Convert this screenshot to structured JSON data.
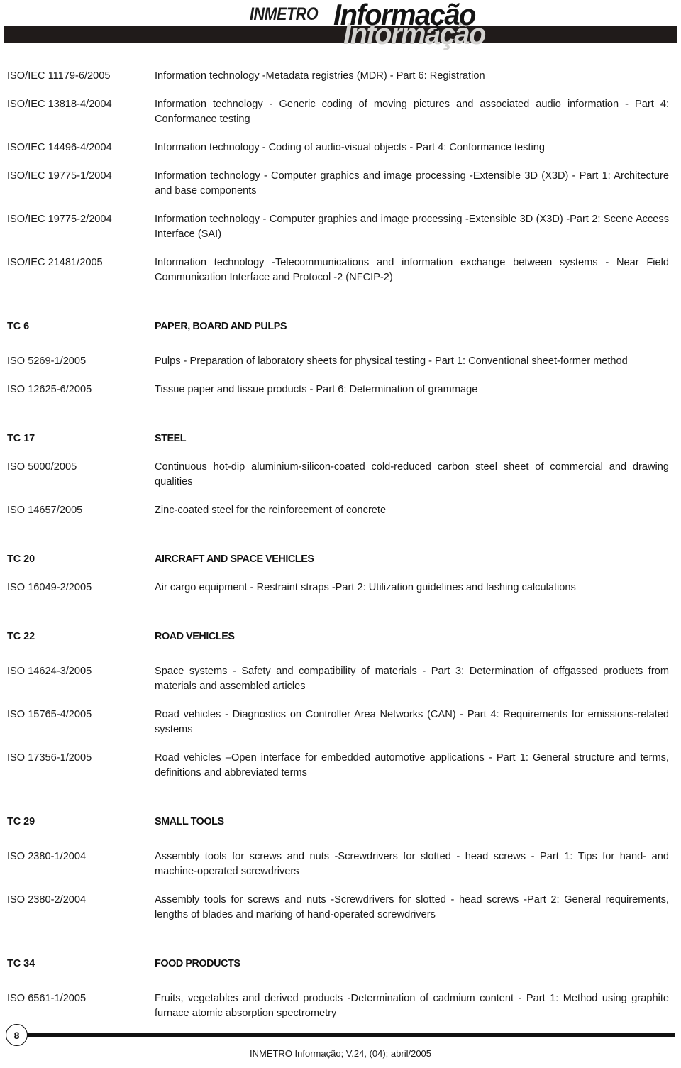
{
  "masthead": {
    "brand": "INMETRO",
    "title": "Informação",
    "title_echo": "Informação",
    "bar_color": "#201b1a",
    "echo_color": "#d3d2d0"
  },
  "sections": [
    {
      "tc_code": "",
      "tc_name": "",
      "entries": [
        {
          "code": "ISO/IEC 11179-6/2005",
          "title": "Information technology -Metadata registries (MDR) - Part 6: Registration"
        },
        {
          "code": "ISO/IEC 13818-4/2004",
          "title": "Information technology - Generic coding of moving pictures and associated audio information - Part 4: Conformance testing"
        },
        {
          "code": "ISO/IEC 14496-4/2004",
          "title": "Information technology - Coding of audio-visual objects - Part 4: Conformance testing"
        },
        {
          "code": "ISO/IEC 19775-1/2004",
          "title": "Information technology - Computer graphics and image processing -Extensible 3D (X3D) - Part 1: Architecture and base components"
        },
        {
          "code": "ISO/IEC 19775-2/2004",
          "title": "Information technology - Computer graphics and image processing -Extensible 3D (X3D) -Part 2: Scene Access Interface (SAI)"
        },
        {
          "code": "ISO/IEC 21481/2005",
          "title": "Information technology -Telecommunications and information exchange between systems - Near Field Communication Interface and Protocol -2 (NFCIP-2)"
        }
      ]
    },
    {
      "tc_code": "TC 6",
      "tc_name": "PAPER, BOARD AND PULPS",
      "entries": [
        {
          "code": "ISO 5269-1/2005",
          "title": "Pulps - Preparation of laboratory sheets for physical testing - Part 1: Conventional sheet-former method"
        },
        {
          "code": "ISO 12625-6/2005",
          "title": "Tissue paper and tissue products - Part 6: Determination of grammage"
        }
      ]
    },
    {
      "tc_code": "TC 17",
      "tc_name": "STEEL",
      "entries": [
        {
          "code": "ISO 5000/2005",
          "title": "Continuous hot-dip aluminium-silicon-coated cold-reduced carbon steel sheet of commercial and drawing qualities"
        },
        {
          "code": "ISO 14657/2005",
          "title": "Zinc-coated steel for the reinforcement of concrete"
        }
      ]
    },
    {
      "tc_code": "TC 20",
      "tc_name": "AIRCRAFT AND SPACE VEHICLES",
      "entries": [
        {
          "code": "ISO 16049-2/2005",
          "title": "Air cargo equipment - Restraint straps -Part 2: Utilization guidelines and lashing calculations"
        }
      ]
    },
    {
      "tc_code": "TC 22",
      "tc_name": "ROAD VEHICLES",
      "entries": [
        {
          "code": "ISO 14624-3/2005",
          "title": "Space systems - Safety and compatibility of materials - Part 3: Determination of offgassed products from materials and assembled articles"
        },
        {
          "code": "ISO 15765-4/2005",
          "title": "Road vehicles - Diagnostics on Controller Area Networks (CAN) - Part 4: Requirements for emissions-related systems"
        },
        {
          "code": "ISO 17356-1/2005",
          "title": "Road vehicles –Open interface for embedded automotive applications - Part 1: General structure and terms, definitions and abbreviated terms"
        }
      ]
    },
    {
      "tc_code": "TC 29",
      "tc_name": "SMALL TOOLS",
      "entries": [
        {
          "code": "ISO 2380-1/2004",
          "title": "Assembly tools for screws and nuts -Screwdrivers for slotted - head screws - Part 1: Tips for hand- and machine-operated screwdrivers"
        },
        {
          "code": "ISO 2380-2/2004",
          "title": "Assembly tools for screws and nuts -Screwdrivers for slotted - head screws -Part 2: General requirements, lengths of blades and marking of hand-operated screwdrivers"
        }
      ]
    },
    {
      "tc_code": "TC 34",
      "tc_name": "FOOD PRODUCTS",
      "entries": [
        {
          "code": "ISO 6561-1/2005",
          "title": "Fruits, vegetables and derived products -Determination of cadmium content - Part 1: Method using graphite furnace atomic absorption spectrometry"
        }
      ]
    }
  ],
  "footer": {
    "page_number": "8",
    "caption": "INMETRO Informação; V.24, (04); abril/2005"
  }
}
